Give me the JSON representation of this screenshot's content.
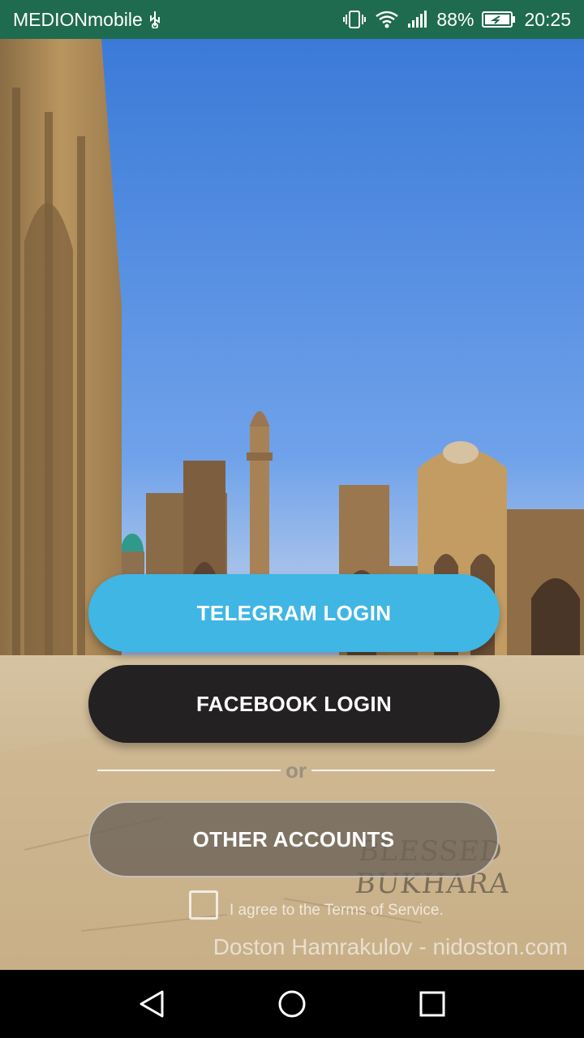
{
  "status_bar": {
    "carrier": "MEDIONmobile",
    "battery": "88%",
    "time": "20:25",
    "icons": [
      "usb-icon",
      "vibrate-icon",
      "wifi-icon",
      "signal-icon",
      "battery-icon"
    ]
  },
  "buttons": {
    "telegram_label": "TELEGRAM LOGIN",
    "facebook_label": "FACEBOOK LOGIN",
    "other_label": "OTHER ACCOUNTS"
  },
  "divider_text": "or",
  "terms_label": "I agree to the Terms of Service.",
  "credit": "Doston Hamrakulov - nidoston.com",
  "watermark": "BLESSED BUKHARA",
  "colors": {
    "status_bar": "#1f6b4f",
    "telegram": "#3fb6e4",
    "facebook": "#232122",
    "other": "#6e645a"
  },
  "nav_icons": [
    "back-icon",
    "home-icon",
    "recents-icon"
  ]
}
